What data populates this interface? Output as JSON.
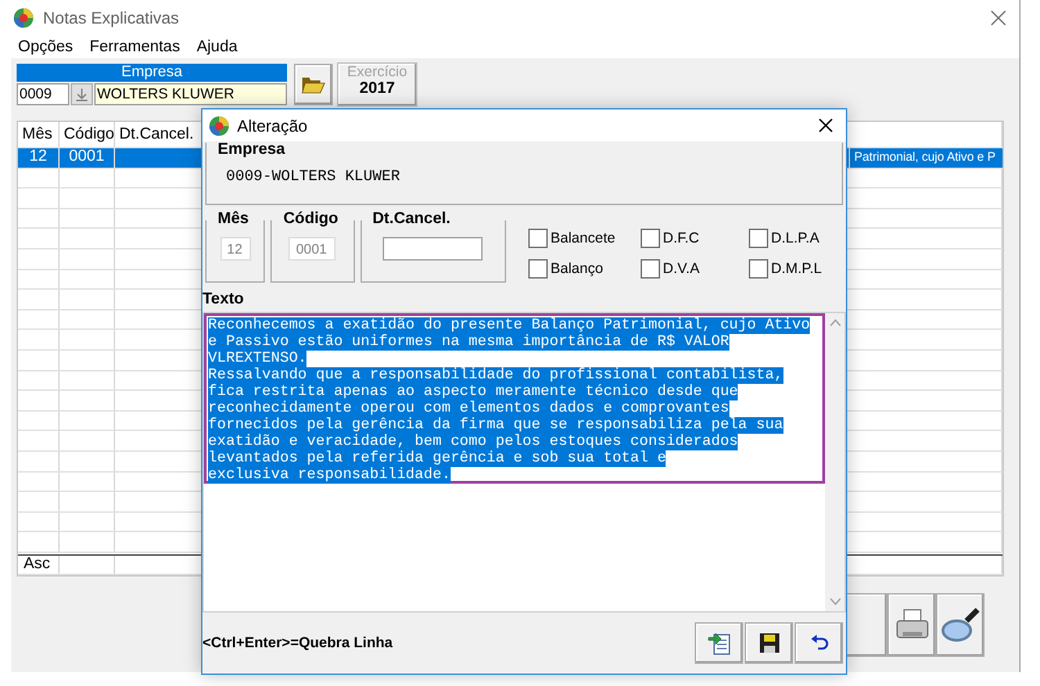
{
  "window": {
    "title": "Notas Explicativas"
  },
  "menu": [
    "Opções",
    "Ferramentas",
    "Ajuda"
  ],
  "empresa": {
    "label": "Empresa",
    "code": "0009",
    "name": "WOLTERS KLUWER"
  },
  "exercicio": {
    "label": "Exercício",
    "value": "2017"
  },
  "grid": {
    "columns": [
      "Mês",
      "Código",
      "Dt.Cancel."
    ],
    "rows": [
      {
        "cells": [
          "12",
          "0001"
        ],
        "text": "Patrimonial, cujo Ativo e P",
        "selected": true
      }
    ],
    "footer": "Asc"
  },
  "dialog": {
    "title": "Alteração",
    "empresa_label": "Empresa",
    "empresa_value": "0009-WOLTERS KLUWER",
    "fields": [
      {
        "label": "Mês",
        "value": "12",
        "disabled": true
      },
      {
        "label": "Código",
        "value": "0001",
        "disabled": true
      },
      {
        "label": "Dt.Cancel.",
        "disabled": false
      }
    ],
    "checkboxes": [
      {
        "label": "Balancete",
        "checked": false
      },
      {
        "label": "Balanço",
        "checked": false
      },
      {
        "label": "D.F.C",
        "checked": false
      },
      {
        "label": "D.V.A",
        "checked": false
      },
      {
        "label": "D.L.P.A",
        "checked": false
      },
      {
        "label": "D.M.P.L",
        "checked": false
      }
    ],
    "text_label": "Texto",
    "text": {
      "selected": true,
      "lines": [
        "Reconhecemos a exatidão do presente Balanço Patrimonial, cujo Ativo",
        "e Passivo estão uniformes na mesma importância de R$ VALOR",
        "VLREXTENSO.",
        "Ressalvando que a responsabilidade do profissional contabilista,",
        "fica restrita apenas ao aspecto meramente técnico desde que",
        "reconhecidamente operou com elementos dados e comprovantes",
        "fornecidos pela gerência da firma que se responsabiliza pela sua",
        "exatidão e veracidade, bem como pelos estoques considerados",
        "levantados pela referida gerência e sob sua total e",
        "exclusiva responsabilidade."
      ]
    },
    "hint": "<Ctrl+Enter>=Quebra Linha"
  }
}
